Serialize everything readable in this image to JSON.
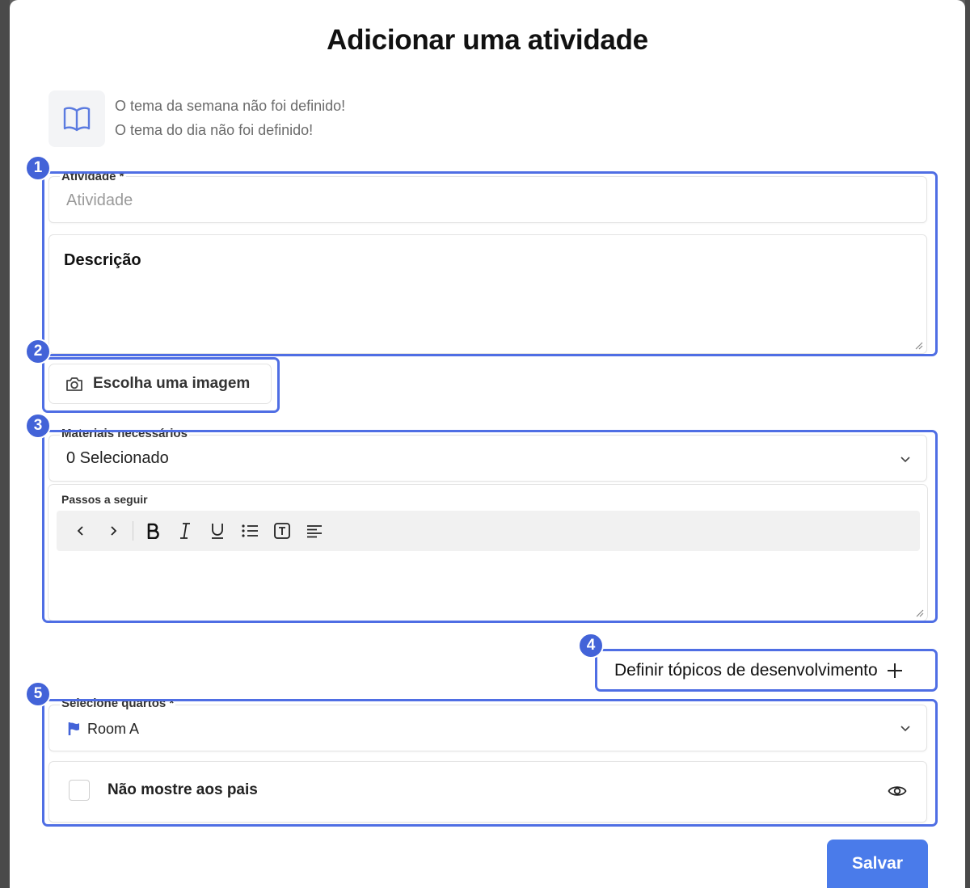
{
  "modal": {
    "title": "Adicionar uma atividade"
  },
  "theme": {
    "icon": "book-open-icon",
    "week_notice": "O tema da semana não foi definido!",
    "day_notice": "O tema do dia não foi definido!"
  },
  "activity": {
    "label": "Atividade *",
    "placeholder": "Atividade",
    "description_label": "Descrição"
  },
  "image": {
    "icon": "camera-icon",
    "button_label": "Escolha uma imagem"
  },
  "materials": {
    "label": "Materiais necessários",
    "value": "0 Selecionado"
  },
  "steps": {
    "label": "Passos a seguir",
    "toolbar": [
      "undo",
      "redo",
      "bold",
      "italic",
      "underline",
      "bullet-list",
      "text-style",
      "align-left"
    ]
  },
  "topics": {
    "button_label": "Definir tópicos de desenvolvimento"
  },
  "rooms": {
    "label": "Selecione quartos *",
    "selected": "Room A"
  },
  "parents": {
    "checkbox_label": "Não mostre aos pais",
    "checked": false
  },
  "actions": {
    "save_label": "Salvar"
  },
  "annotations": [
    "1",
    "2",
    "3",
    "4",
    "5"
  ],
  "colors": {
    "highlight": "#4f6ee4",
    "badge": "#4363d8",
    "primary": "#4a7bea",
    "chip_flag": "#4363d8"
  }
}
